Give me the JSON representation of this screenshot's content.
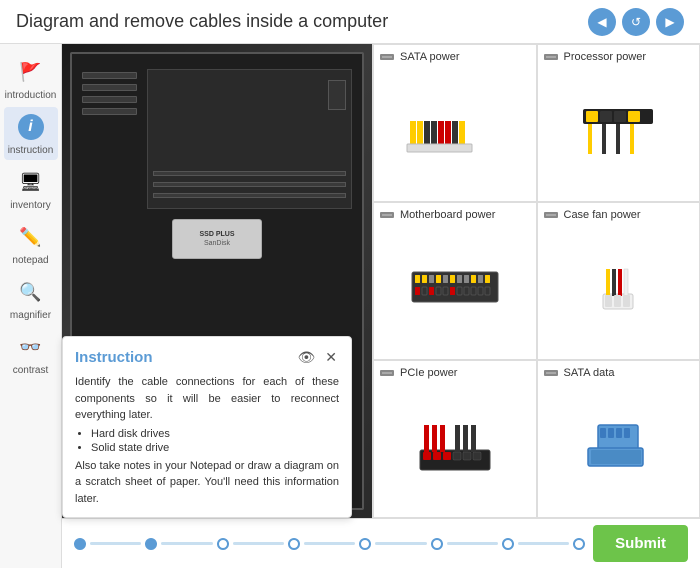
{
  "header": {
    "title": "Diagram and remove cables inside a computer",
    "nav": {
      "back_label": "◀",
      "refresh_label": "↺",
      "forward_label": "▶"
    }
  },
  "sidebar": {
    "items": [
      {
        "id": "introduction",
        "label": "introduction",
        "icon": "🚩"
      },
      {
        "id": "instruction",
        "label": "instruction",
        "icon": "i",
        "active": true
      },
      {
        "id": "inventory",
        "label": "inventory",
        "icon": "🖥"
      },
      {
        "id": "notepad",
        "label": "notepad",
        "icon": "✏"
      },
      {
        "id": "magnifier",
        "label": "magnifier",
        "icon": "🔍"
      },
      {
        "id": "contrast",
        "label": "contrast",
        "icon": "👓"
      }
    ]
  },
  "components": [
    {
      "id": "sata-power",
      "name": "SATA power",
      "type": "sata-power"
    },
    {
      "id": "processor-power",
      "name": "Processor power",
      "type": "processor"
    },
    {
      "id": "motherboard-power",
      "name": "Motherboard power",
      "type": "motherboard"
    },
    {
      "id": "case-fan-power",
      "name": "Case fan power",
      "type": "casefan"
    },
    {
      "id": "pcie-power",
      "name": "PCIe power",
      "type": "pcie"
    },
    {
      "id": "sata-data",
      "name": "SATA data",
      "type": "sata-data"
    }
  ],
  "instruction_popup": {
    "title": "Instruction",
    "body1": "Identify the cable connections for each of these components so it will be easier to reconnect everything later.",
    "list": [
      "Hard disk drives",
      "Solid state drive"
    ],
    "body2": "Also take notes in your Notepad or draw a diagram on a scratch sheet of paper. You'll need this information later."
  },
  "bottom": {
    "submit_label": "Submit"
  },
  "drive_label": "SanDisk",
  "drive_model": "SSD PLUS"
}
